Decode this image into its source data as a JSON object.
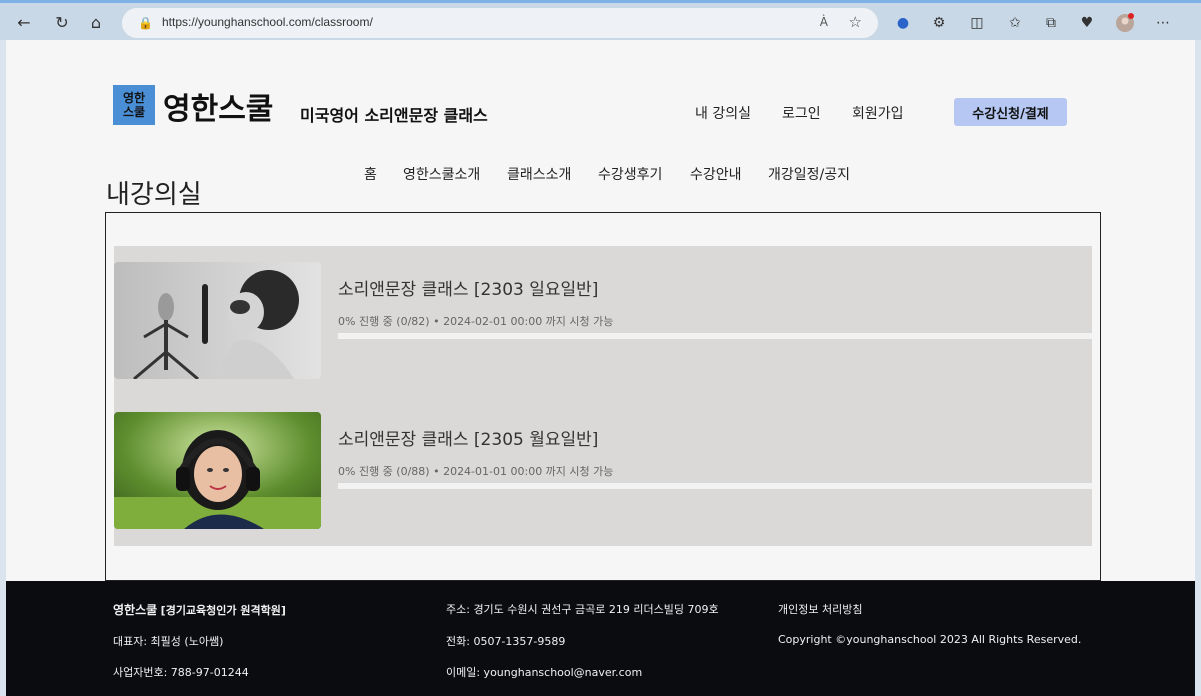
{
  "browser": {
    "url": "https://younghanschool.com/classroom/",
    "read_aloud": "À",
    "icons": [
      "back-icon",
      "refresh-icon",
      "home-icon",
      "lock-icon",
      "favorite-star-icon",
      "shield-icon",
      "extensions-icon",
      "split-screen-icon",
      "favorites-icon",
      "collections-icon",
      "performance-icon",
      "profile-icon",
      "more-icon"
    ]
  },
  "header": {
    "logo_line1": "영한",
    "logo_line2": "스쿨",
    "brand": "영한스쿨",
    "tagline": "미국영어 소리앤문장 클래스",
    "links": [
      "내 강의실",
      "로그인",
      "회원가입"
    ],
    "cta": "수강신청/결제"
  },
  "nav": [
    "홈",
    "영한스쿨소개",
    "클래스소개",
    "수강생후기",
    "수강안내",
    "개강일정/공지"
  ],
  "page_title": "내강의실",
  "courses": [
    {
      "title": "소리앤문장 클래스 [2303 일요일반]",
      "meta": "0% 진행 중 (0/82) • 2024-02-01 00:00 까지 시청 가능",
      "progress": 0
    },
    {
      "title": "소리앤문장 클래스 [2305 월요일반]",
      "meta": "0% 진행 중 (0/88) • 2024-01-01 00:00 까지 시청 가능",
      "progress": 0
    }
  ],
  "footer": {
    "brand": "영한스쿨",
    "brand_note": "[경기교육청인가 원격학원]",
    "ceo": "대표자: 최필성 (노아쌤)",
    "biz_no": "사업자번호: 788-97-01244",
    "address": "주소: 경기도 수원시 권선구 금곡로 219 리더스빌딩 709호",
    "phone": "전화: 0507-1357-9589",
    "email": "이메일: younghanschool@naver.com",
    "privacy": "개인정보 처리방침",
    "copyright": "Copyright ©younghanschool 2023 All Rights Reserved."
  }
}
